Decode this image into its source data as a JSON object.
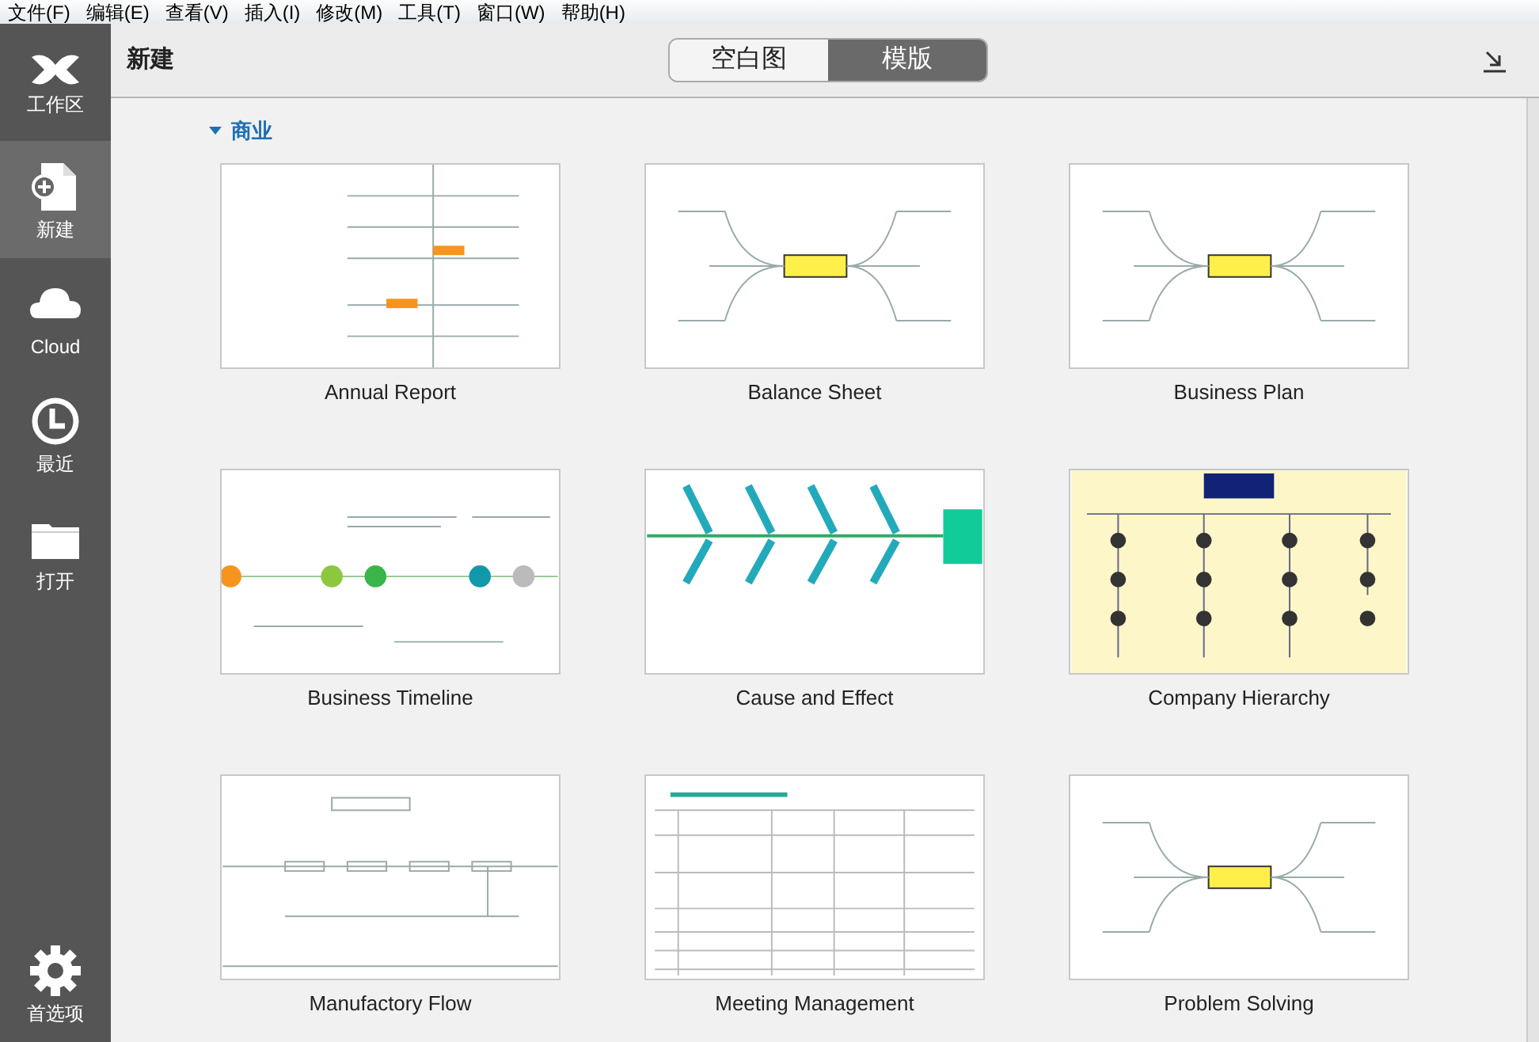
{
  "menu_bar": [
    "文件(F)",
    "编辑(E)",
    "查看(V)",
    "插入(I)",
    "修改(M)",
    "工具(T)",
    "窗口(W)",
    "帮助(H)"
  ],
  "sidebar": {
    "items": [
      {
        "label": "工作区",
        "kind": "logo",
        "selected": false
      },
      {
        "label": "新建",
        "kind": "new",
        "selected": true
      },
      {
        "label": "Cloud",
        "kind": "cloud",
        "selected": false
      },
      {
        "label": "最近",
        "kind": "recent",
        "selected": false
      },
      {
        "label": "打开",
        "kind": "open",
        "selected": false
      }
    ],
    "footer": {
      "label": "首选项",
      "kind": "settings",
      "selected": false
    }
  },
  "header": {
    "title": "新建",
    "tabs": [
      {
        "label": "空白图",
        "selected": false
      },
      {
        "label": "模版",
        "selected": true
      }
    ]
  },
  "section": {
    "title": "商业",
    "expanded": true,
    "templates": [
      {
        "name": "Annual Report",
        "kind": "tree"
      },
      {
        "name": "Balance Sheet",
        "kind": "mindmap"
      },
      {
        "name": "Business Plan",
        "kind": "mindmap"
      },
      {
        "name": "Business Timeline",
        "kind": "timeline"
      },
      {
        "name": "Cause and Effect",
        "kind": "fishbone"
      },
      {
        "name": "Company Hierarchy",
        "kind": "org"
      },
      {
        "name": "Manufactory Flow",
        "kind": "flow"
      },
      {
        "name": "Meeting Management",
        "kind": "table"
      },
      {
        "name": "Problem Solving",
        "kind": "mindmap"
      }
    ]
  }
}
